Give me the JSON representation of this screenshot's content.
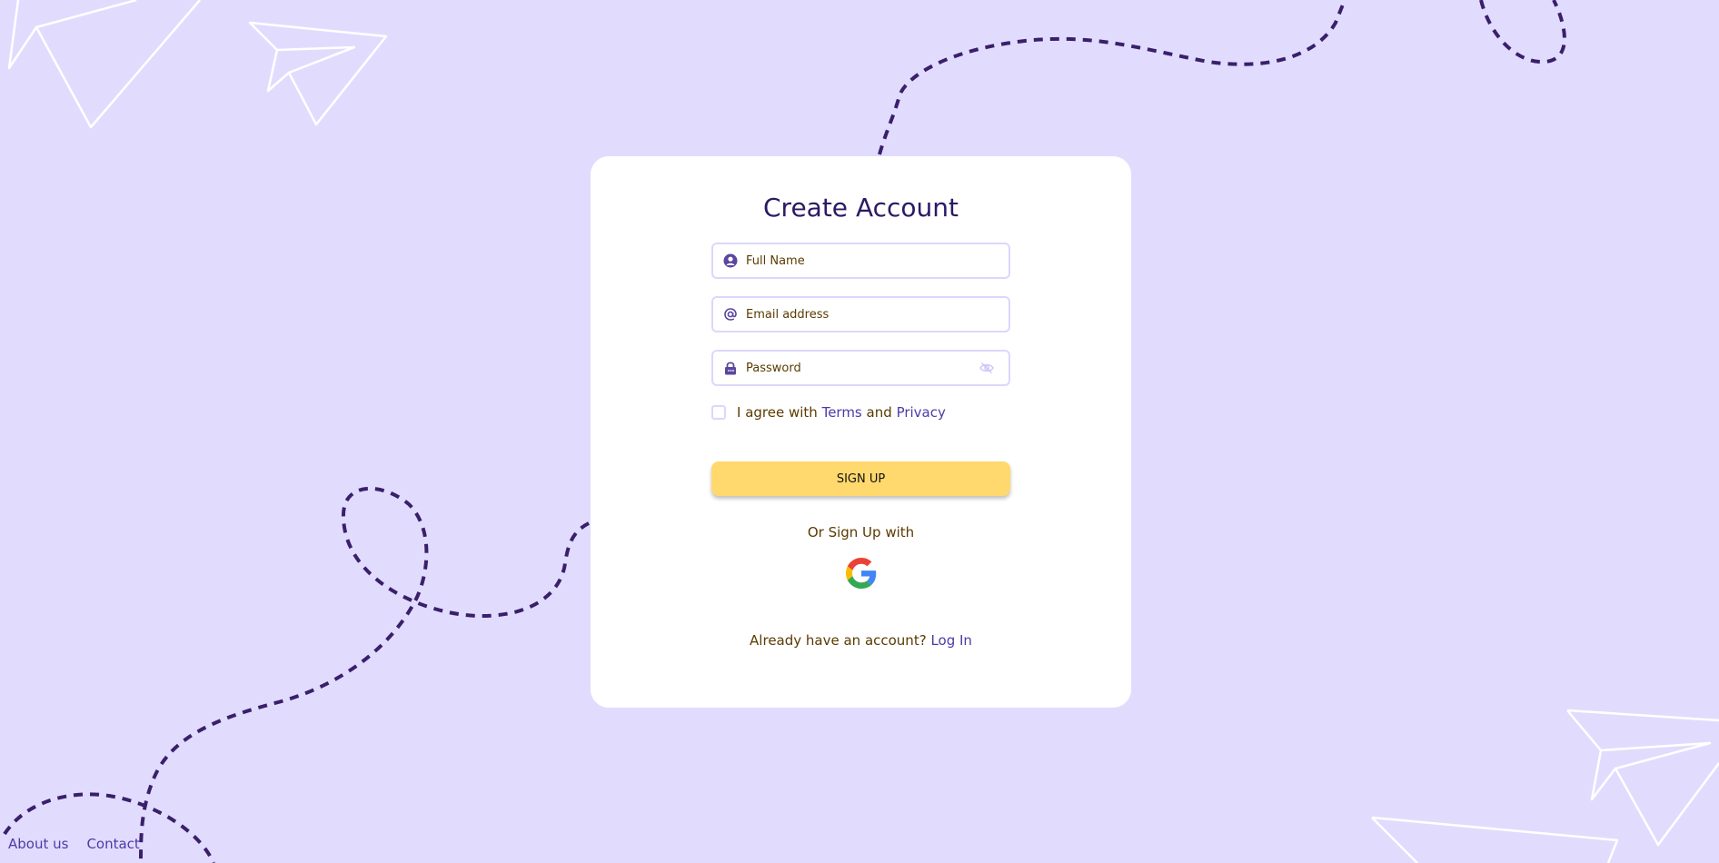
{
  "signup": {
    "title": "Create Account",
    "full_name_placeholder": "Full Name",
    "email_placeholder": "Email address",
    "password_placeholder": "Password",
    "agree_prefix": "I agree with",
    "terms_link": "Terms",
    "agree_and": "and",
    "privacy_link": "Privacy",
    "signup_button": "SIGN UP",
    "or_text": "Or Sign Up with",
    "already_text": "Already have an account?",
    "login_link": "Log In"
  },
  "footer": {
    "links": [
      "About us",
      "Contact"
    ]
  },
  "colors": {
    "background": "#e1dcfe",
    "card": "#ffffff",
    "title": "#2b1a63",
    "accent": "#4f3aa6",
    "button": "#ffd96e",
    "text": "#5a3b00",
    "field_border": "#ddd6fd"
  },
  "icons": [
    "user-icon",
    "at-icon",
    "lock-icon",
    "eye-slash-icon",
    "google-icon",
    "paper-plane-icon"
  ]
}
